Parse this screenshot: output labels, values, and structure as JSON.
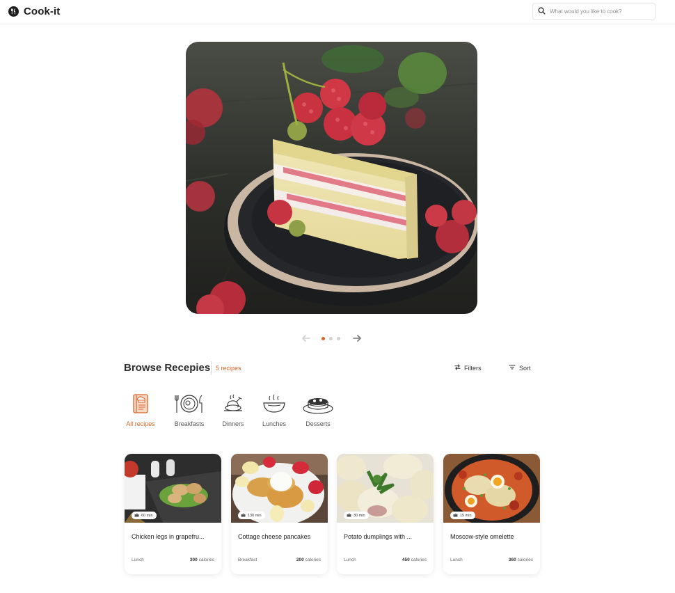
{
  "app": {
    "name": "Cook-it",
    "logo_icon": "fork-knife-icon"
  },
  "search": {
    "placeholder": "What would you like to cook?",
    "value": "",
    "icon": "search-icon"
  },
  "hero": {
    "image": "raspberry cake slice",
    "active_slide": 1,
    "slide_count": 3
  },
  "browse": {
    "title": "Browse Recepies",
    "count": "5 recipes",
    "filters_label": "Filters",
    "sort_label": "Sort"
  },
  "categories": [
    {
      "label": "All recipes",
      "icon": "cookbook-icon",
      "active": true
    },
    {
      "label": "Breakfasts",
      "icon": "plate-cutlery-icon",
      "active": false
    },
    {
      "label": "Dinners",
      "icon": "roast-chicken-icon",
      "active": false
    },
    {
      "label": "Lunches",
      "icon": "soup-bowl-icon",
      "active": false
    },
    {
      "label": "Desserts",
      "icon": "cake-icon",
      "active": false
    }
  ],
  "recipes": [
    {
      "title": "Chicken legs in grapefru...",
      "time": "60 min",
      "meal": "Lunch",
      "calories_value": "300",
      "calories_unit": "calories"
    },
    {
      "title": "Cottage cheese pancakes",
      "time": "130 min",
      "meal": "Breakfast",
      "calories_value": "200",
      "calories_unit": "calories"
    },
    {
      "title": "Potato dumplings with ...",
      "time": "30 min",
      "meal": "Lunch",
      "calories_value": "450",
      "calories_unit": "calories"
    },
    {
      "title": "Moscow-style omelette",
      "time": "15 min",
      "meal": "Lunch",
      "calories_value": "360",
      "calories_unit": "calories"
    }
  ],
  "colors": {
    "accent": "#d9652b",
    "text": "#222222",
    "border": "#e3e3e3"
  }
}
